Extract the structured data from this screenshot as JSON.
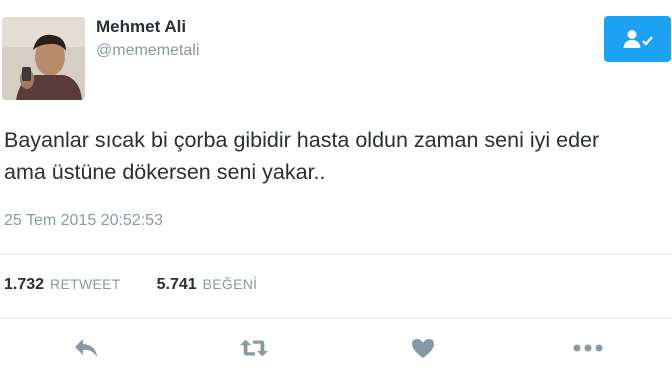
{
  "user": {
    "name": "Mehmet Ali",
    "handle": "@mememetali"
  },
  "follow_button": {
    "icon": "follow-user-check-icon"
  },
  "tweet": {
    "lines": [
      "Bayanlar sıcak bi çorba gibidir hasta oldun zaman seni iyi eder",
      "ama üstüne dökersen seni yakar.."
    ],
    "timestamp": "25 Tem 2015 20:52:53"
  },
  "stats": {
    "retweets": {
      "count": "1.732",
      "label": "RETWEET"
    },
    "likes": {
      "count": "5.741",
      "label": "BEĞENİ"
    }
  },
  "actions": [
    {
      "name": "reply",
      "icon": "reply-icon"
    },
    {
      "name": "retweet",
      "icon": "retweet-icon"
    },
    {
      "name": "like",
      "icon": "heart-icon"
    },
    {
      "name": "more",
      "icon": "more-dots-icon"
    }
  ],
  "colors": {
    "accent": "#1da1f2",
    "text": "#292f33",
    "muted": "#8899a6",
    "divider": "#e1e8ed"
  }
}
